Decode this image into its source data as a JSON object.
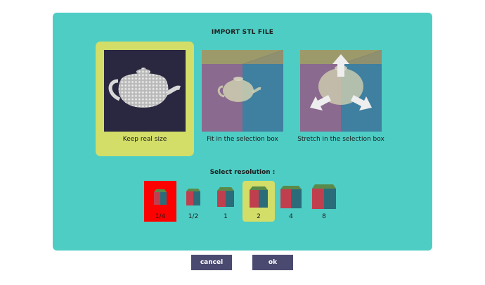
{
  "dialog": {
    "title": "IMPORT STL FILE",
    "modes": [
      {
        "label": "Keep real size",
        "selected": true
      },
      {
        "label": "Fit in the selection box",
        "selected": false
      },
      {
        "label": "Stretch in the selection box",
        "selected": false
      }
    ],
    "resolution": {
      "title": "Select resolution :",
      "options": [
        {
          "label": "1/4",
          "state": "active"
        },
        {
          "label": "1/2",
          "state": "normal"
        },
        {
          "label": "1",
          "state": "normal"
        },
        {
          "label": "2",
          "state": "selected"
        },
        {
          "label": "4",
          "state": "normal"
        },
        {
          "label": "8",
          "state": "normal"
        }
      ]
    }
  },
  "buttons": {
    "cancel": "cancel",
    "ok": "ok"
  },
  "colors": {
    "dialog_bg": "#4ecdc4",
    "selected_bg": "#d2de68",
    "active_bg": "#ff0000",
    "button_bg": "#4a4a70",
    "thumb_bg": "#2a2840"
  }
}
